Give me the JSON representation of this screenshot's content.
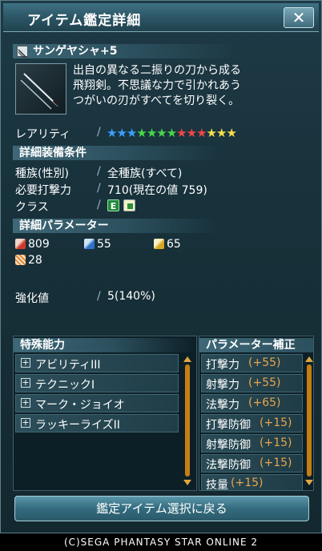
{
  "window": {
    "title": "アイテム鑑定詳細",
    "close_label": "✕"
  },
  "item": {
    "name": "サンゲヤシャ+5",
    "description_lines": [
      "出自の異なる二振りの刀から成る",
      "飛翔剣。不思議な力で引かれあう",
      "つがいの刃がすべてを切り裂く。"
    ]
  },
  "rarity": {
    "label": "レアリティ",
    "separator": "/",
    "stars": 13,
    "star_colors": [
      "#3aa0ff",
      "#3aa0ff",
      "#3aa0ff",
      "#49d84a",
      "#49d84a",
      "#49d84a",
      "#49d84a",
      "#f04646",
      "#f04646",
      "#f04646",
      "#f5e04a",
      "#f5e04a",
      "#f5e04a"
    ]
  },
  "equip": {
    "header": "詳細装備条件",
    "race_label": "種族(性別)",
    "race_value": "全種族(すべて)",
    "atk_label": "必要打撃力",
    "atk_value": "710(現在の値 759)",
    "class_label": "クラス",
    "separator": "/"
  },
  "params": {
    "header": "詳細パラメーター",
    "melee": "809",
    "ranged": "55",
    "tech": "65",
    "dex": "28"
  },
  "grind": {
    "label": "強化値",
    "separator": "/",
    "value": "5(140%)"
  },
  "abilities": {
    "header": "特殊能力",
    "items": [
      "アビリティIII",
      "テクニックI",
      "マーク・ジョイオ",
      "ラッキーライズII"
    ]
  },
  "modifiers": {
    "header": "パラメーター補正",
    "items": [
      {
        "name": "打撃力",
        "value": "(+55)"
      },
      {
        "name": "射撃力",
        "value": "(+55)"
      },
      {
        "name": "法撃力",
        "value": "(+65)"
      },
      {
        "name": "打撃防御",
        "value": "(+15)"
      },
      {
        "name": "射撃防御",
        "value": "(+15)"
      },
      {
        "name": "法撃防御",
        "value": "(+15)"
      },
      {
        "name": "技量",
        "value": "(+15)"
      }
    ]
  },
  "back_button": "鑑定アイテム選択に戻る",
  "footer": "(C)SEGA PHANTASY STAR ONLINE 2"
}
